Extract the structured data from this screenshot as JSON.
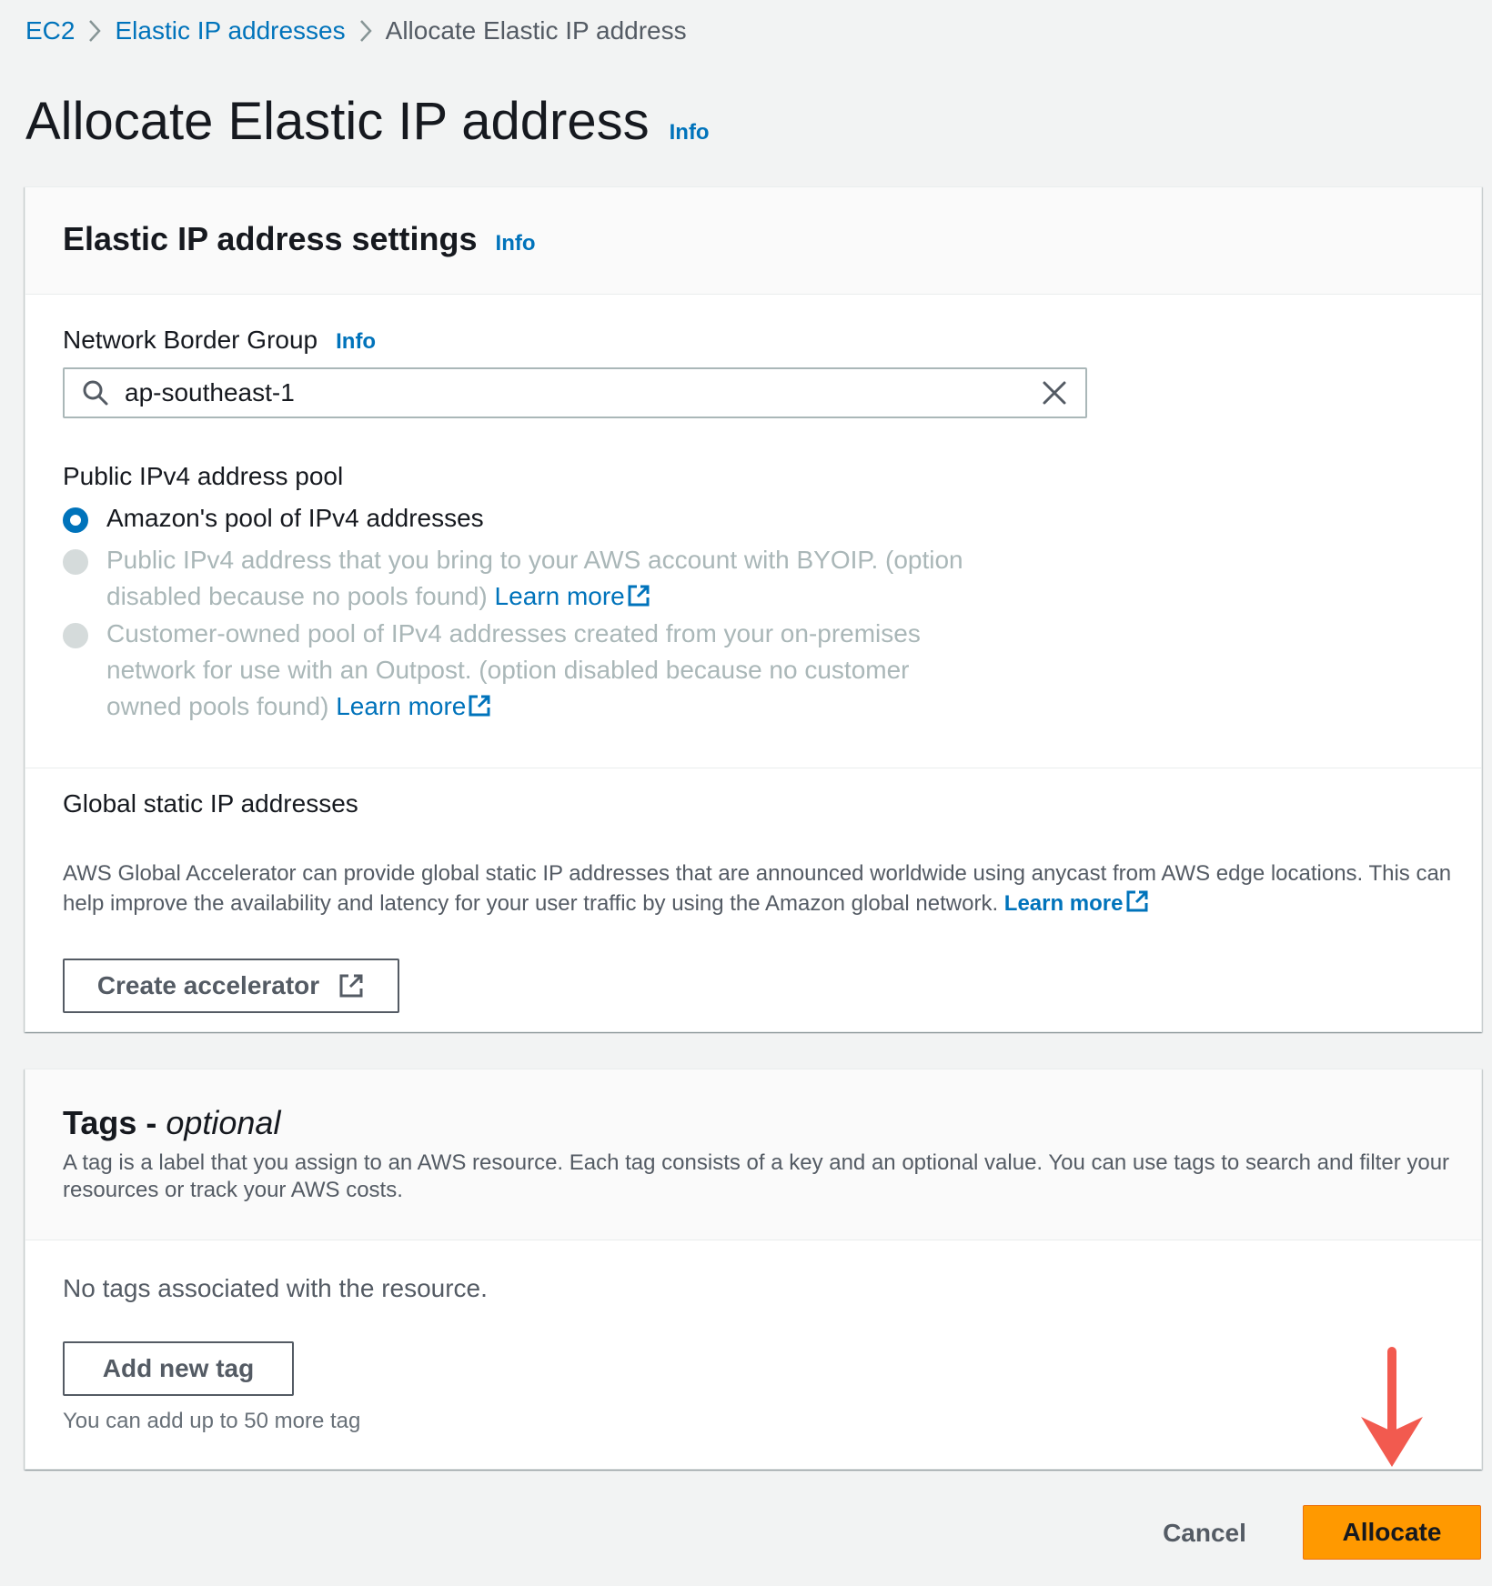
{
  "breadcrumb": {
    "items": [
      "EC2",
      "Elastic IP addresses",
      "Allocate Elastic IP address"
    ]
  },
  "page": {
    "title": "Allocate Elastic IP address",
    "info_label": "Info"
  },
  "settings": {
    "heading": "Elastic IP address settings",
    "info_label": "Info",
    "network_border_group": {
      "label": "Network Border Group",
      "info_label": "Info",
      "value": "ap-southeast-1"
    },
    "pool": {
      "label": "Public IPv4 address pool",
      "options": [
        {
          "text": "Amazon's pool of IPv4 addresses",
          "selected": true,
          "disabled": false
        },
        {
          "text": "Public IPv4 address that you bring to your AWS account with BYOIP. (option disabled because no pools found)",
          "link": "Learn more",
          "selected": false,
          "disabled": true
        },
        {
          "text": "Customer-owned pool of IPv4 addresses created from your on-premises network for use with an Outpost. (option disabled because no customer owned pools found)",
          "link": "Learn more",
          "selected": false,
          "disabled": true
        }
      ]
    },
    "global": {
      "title": "Global static IP addresses",
      "description": "AWS Global Accelerator can provide global static IP addresses that are announced worldwide using anycast from AWS edge locations. This can help improve the availability and latency for your user traffic by using the Amazon global network.",
      "link": "Learn more",
      "button": "Create accelerator"
    }
  },
  "tags": {
    "heading": "Tags - ",
    "heading_optional": "optional",
    "description": "A tag is a label that you assign to an AWS resource. Each tag consists of a key and an optional value. You can use tags to search and filter your resources or track your AWS costs.",
    "empty_text": "No tags associated with the resource.",
    "add_button": "Add new tag",
    "limit_text": "You can add up to 50 more tag"
  },
  "actions": {
    "cancel": "Cancel",
    "allocate": "Allocate"
  },
  "colors": {
    "link": "#0073bb",
    "primary_button": "#ff9900",
    "annotation_arrow": "#f25a4f"
  }
}
